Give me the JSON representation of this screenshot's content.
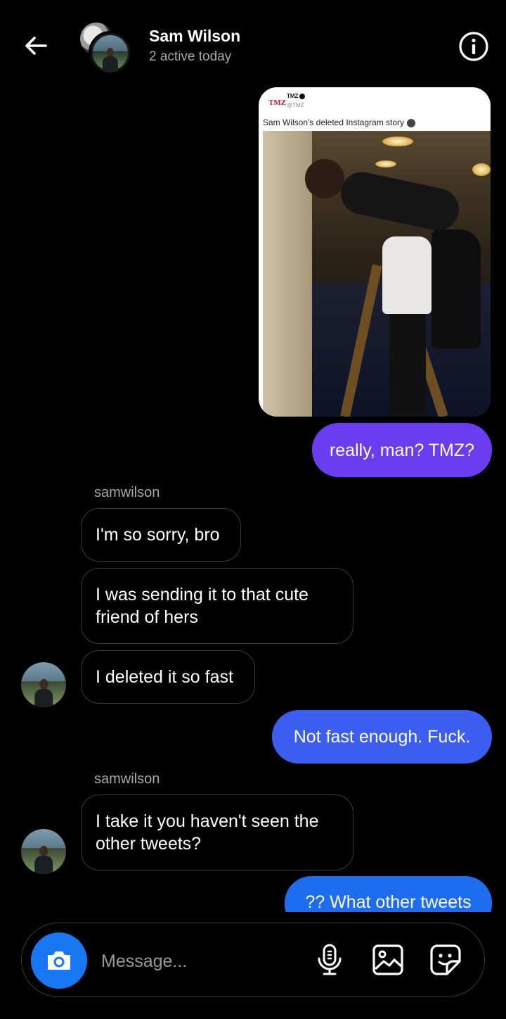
{
  "header": {
    "title": "Sam Wilson",
    "subtitle": "2 active today",
    "icons": {
      "back": "arrow-left-icon",
      "info": "info-circle-icon"
    }
  },
  "shared_post": {
    "source_logo": "TMZ",
    "source_name": "TMZ",
    "source_handle": "@TMZ",
    "caption": "Sam Wilson's deleted Instagram story",
    "caption_emoji": "skull-icon"
  },
  "messages": [
    {
      "direction": "outgoing",
      "text": "really, man? TMZ?",
      "color": "#6a3ef0"
    },
    {
      "direction": "incoming",
      "sender": "samwilson",
      "text": "I'm so sorry, bro"
    },
    {
      "direction": "incoming",
      "text_lines": [
        "I was sending it to that cute",
        "friend of hers"
      ]
    },
    {
      "direction": "incoming",
      "text": "I deleted it so fast"
    },
    {
      "direction": "outgoing",
      "text": "Not fast enough. Fuck.",
      "color": "#3b5ef0"
    },
    {
      "direction": "incoming",
      "sender": "samwilson",
      "text_lines": [
        "I take it you haven't seen the",
        "other tweets?"
      ]
    },
    {
      "direction": "outgoing",
      "text": "?? What other tweets",
      "color": "#1e6cf0"
    }
  ],
  "composer": {
    "placeholder": "Message...",
    "camera_color": "#1877f2",
    "icons": {
      "camera": "camera-icon",
      "mic": "microphone-icon",
      "gallery": "image-icon",
      "sticker": "sticker-icon"
    }
  }
}
